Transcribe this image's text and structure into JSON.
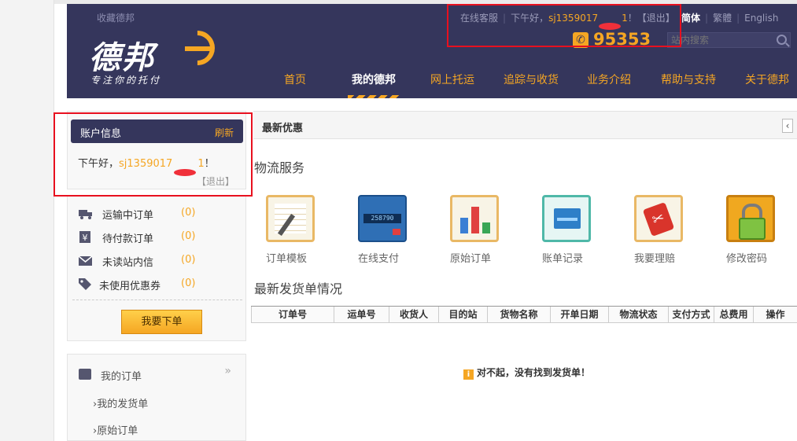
{
  "header": {
    "favorite": "收藏德邦",
    "logo_text": "德邦",
    "logo_slogan": "专注你的托付",
    "online_service": "在线客服",
    "greeting": "下午好，",
    "username": "sj1359017",
    "username_suffix": "1",
    "exclaim": "！",
    "logout": "【退出】",
    "lang_simplified": "简体",
    "lang_traditional": "繁體",
    "lang_english": "English",
    "phone": "95353",
    "search_placeholder": "站内搜索"
  },
  "nav": {
    "items": [
      "首页",
      "我的德邦",
      "网上托运",
      "追踪与收货",
      "业务介绍",
      "帮助与支持",
      "关于德邦"
    ],
    "active": "我的德邦"
  },
  "account": {
    "title": "账户信息",
    "refresh": "刷新",
    "greeting": "下午好，",
    "username": "sj1359017",
    "username_suffix": "1",
    "exclaim": "！",
    "logout": "【退出】"
  },
  "stats": [
    {
      "label": "运输中订单",
      "count": "(0)",
      "icon": "truck-icon"
    },
    {
      "label": "待付款订单",
      "count": "(0)",
      "icon": "yen-icon"
    },
    {
      "label": "未读站内信",
      "count": "(0)",
      "icon": "mail-icon"
    },
    {
      "label": "未使用优惠券",
      "count": "(0)",
      "icon": "tag-icon"
    }
  ],
  "order_button": "我要下单",
  "my_orders": {
    "title": "我的订单",
    "chevron": "»",
    "items": [
      "›我的发货单",
      "›原始订单"
    ]
  },
  "promo": {
    "title": "最新优惠",
    "collapse": "‹"
  },
  "services": {
    "title": "物流服务",
    "items": [
      {
        "label": "订单模板",
        "icon": "order-template-icon"
      },
      {
        "label": "在线支付",
        "icon": "online-payment-icon"
      },
      {
        "label": "原始订单",
        "icon": "original-order-icon"
      },
      {
        "label": "账单记录",
        "icon": "bill-record-icon"
      },
      {
        "label": "我要理赔",
        "icon": "claim-icon"
      },
      {
        "label": "修改密码",
        "icon": "change-password-icon"
      }
    ]
  },
  "shipments": {
    "title": "最新发货单情况",
    "columns": [
      "订单号",
      "运单号",
      "收货人",
      "目的站",
      "货物名称",
      "开单日期",
      "物流状态",
      "支付方式",
      "总费用",
      "操作"
    ],
    "empty_message": "对不起，没有找到发货单！"
  },
  "colors": {
    "header_bg": "#35365c",
    "accent": "#f5a623",
    "highlight": "#e8101f"
  }
}
